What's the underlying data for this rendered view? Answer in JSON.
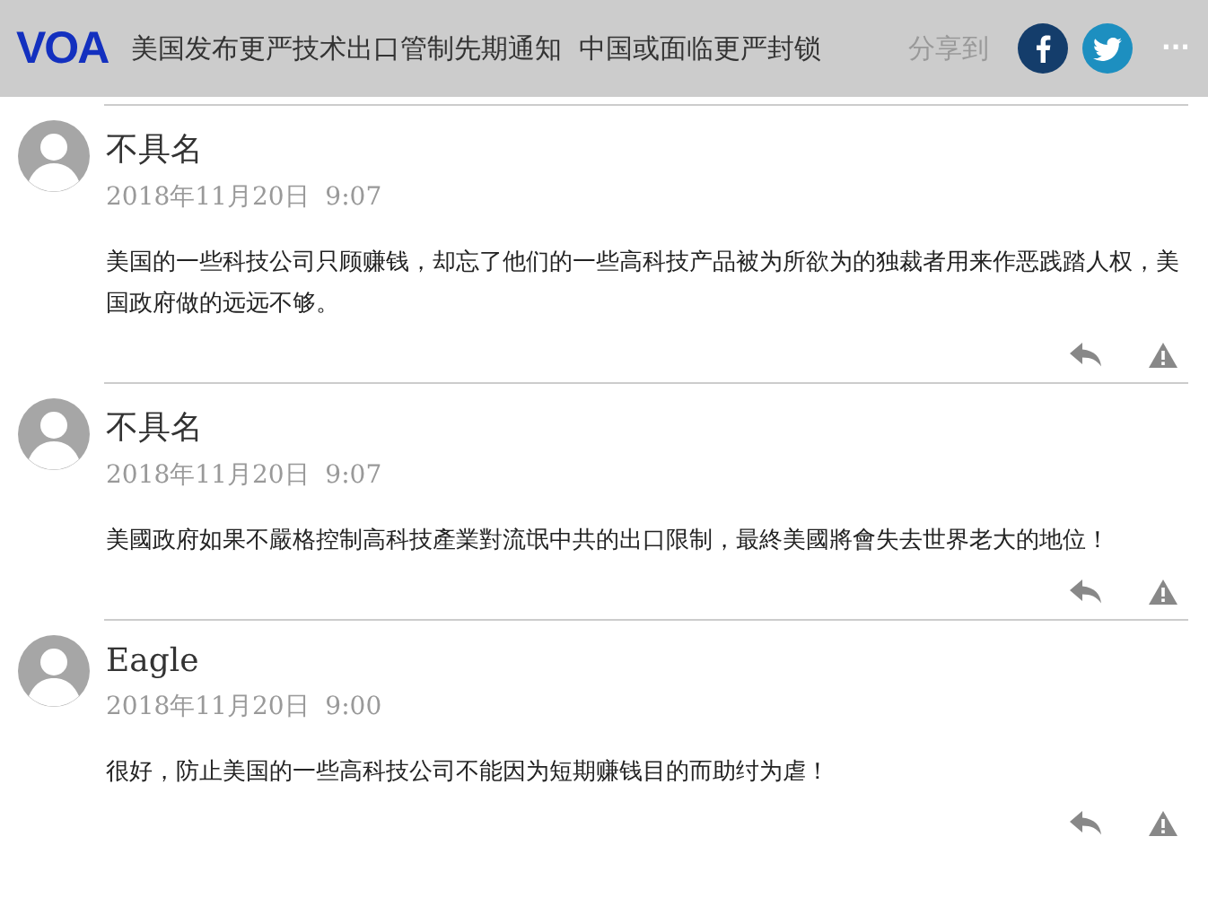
{
  "header": {
    "logo": "VOA",
    "title": "美国发布更严技术出口管制先期通知  中国或面临更严封锁",
    "share_label": "分享到",
    "more": "···"
  },
  "comments": [
    {
      "author": "不具名",
      "date": "2018年11月20日  9:07",
      "text": "美国的一些科技公司只顾赚钱，却忘了他们的一些高科技产品被为所欲为的独裁者用来作恶践踏人权，美国政府做的远远不够。"
    },
    {
      "author": "不具名",
      "date": "2018年11月20日  9:07",
      "text": "美國政府如果不嚴格控制高科技產業對流氓中共的出口限制，最終美國將會失去世界老大的地位！"
    },
    {
      "author": "Eagle",
      "date": "2018年11月20日  9:00",
      "text": "很好，防止美国的一些高科技公司不能因为短期赚钱目的而助纣为虐！"
    }
  ]
}
